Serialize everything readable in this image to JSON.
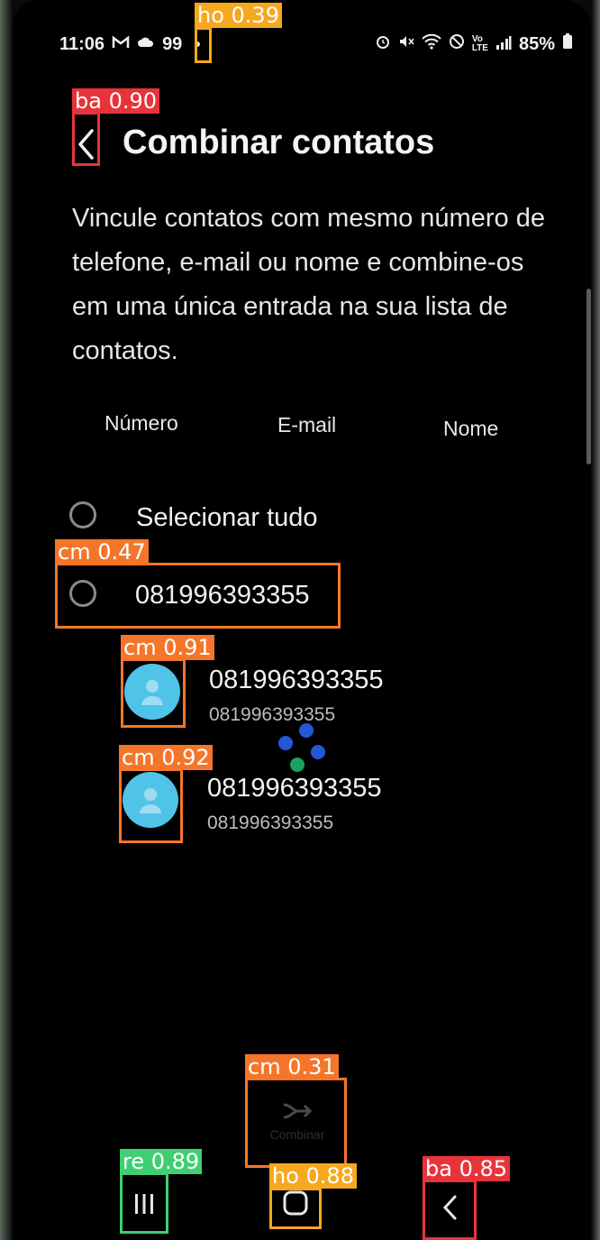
{
  "status_bar": {
    "time": "11:06",
    "notif_count": "99",
    "battery": "85%",
    "icons": [
      "gmail-icon",
      "cloud-icon",
      "alarm-icon",
      "mute-icon",
      "wifi-icon",
      "block-icon",
      "volte-icon",
      "signal-icon",
      "battery-icon"
    ]
  },
  "header": {
    "title": "Combinar contatos",
    "back_icon": "chevron-left-icon"
  },
  "description": "Vincule contatos com mesmo número de telefone, e-mail ou nome e combine-os em uma única entrada na sua lista de contatos.",
  "tabs": [
    {
      "label": "Número"
    },
    {
      "label": "E-mail"
    },
    {
      "label": "Nome"
    }
  ],
  "select_all": {
    "label": "Selecionar tudo",
    "checked": false
  },
  "group": {
    "label": "081996393355",
    "checked": false
  },
  "contacts": [
    {
      "name": "081996393355",
      "detail": "081996393355",
      "avatar_icon": "person-icon"
    },
    {
      "name": "081996393355",
      "detail": "081996393355",
      "avatar_icon": "person-icon"
    }
  ],
  "bottom_action": {
    "label": "Combinar",
    "icon": "merge-arrow-icon"
  },
  "colors": {
    "avatar": "#4fc3e8",
    "det_red": "#e8333b",
    "det_orange": "#f5762a",
    "det_yellow": "#f6a81e",
    "det_green": "#3fcf73"
  },
  "detections": [
    {
      "label": "ho 0.39",
      "color": "yellow"
    },
    {
      "label": "ba 0.90",
      "color": "red"
    },
    {
      "label": "cm 0.47",
      "color": "orange"
    },
    {
      "label": "cm 0.91",
      "color": "orange"
    },
    {
      "label": "cm 0.92",
      "color": "orange"
    },
    {
      "label": "cm 0.31",
      "color": "orange"
    },
    {
      "label": "re 0.89",
      "color": "green"
    },
    {
      "label": "ho 0.88",
      "color": "yellow"
    },
    {
      "label": "ba 0.85",
      "color": "red"
    }
  ],
  "navigation": {
    "recents_icon": "recents-icon",
    "home_icon": "home-icon",
    "back_icon": "back-nav-icon"
  }
}
